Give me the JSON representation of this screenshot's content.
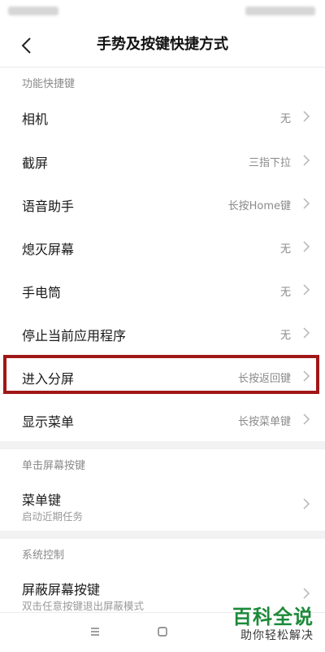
{
  "header": {
    "title": "手势及按键快捷方式"
  },
  "sections": [
    {
      "label": "功能快捷键",
      "items": [
        {
          "label": "相机",
          "value": "无"
        },
        {
          "label": "截屏",
          "value": "三指下拉"
        },
        {
          "label": "语音助手",
          "value": "长按Home键"
        },
        {
          "label": "熄灭屏幕",
          "value": "无"
        },
        {
          "label": "手电筒",
          "value": "无"
        },
        {
          "label": "停止当前应用程序",
          "value": "无"
        },
        {
          "label": "进入分屏",
          "value": "长按返回键"
        },
        {
          "label": "显示菜单",
          "value": "长按菜单键"
        }
      ]
    },
    {
      "label": "单击屏幕按键",
      "items": [
        {
          "label": "菜单键",
          "sublabel": "启动近期任务"
        }
      ]
    },
    {
      "label": "系统控制",
      "items": [
        {
          "label": "屏蔽屏幕按键",
          "sublabel": "双击任意按键退出屏蔽模式"
        }
      ]
    }
  ],
  "watermark": {
    "title": "百科全说",
    "subtitle": "助你轻松解决"
  },
  "colors": {
    "highlight": "#a01717",
    "watermark": "#1d8a3a"
  }
}
